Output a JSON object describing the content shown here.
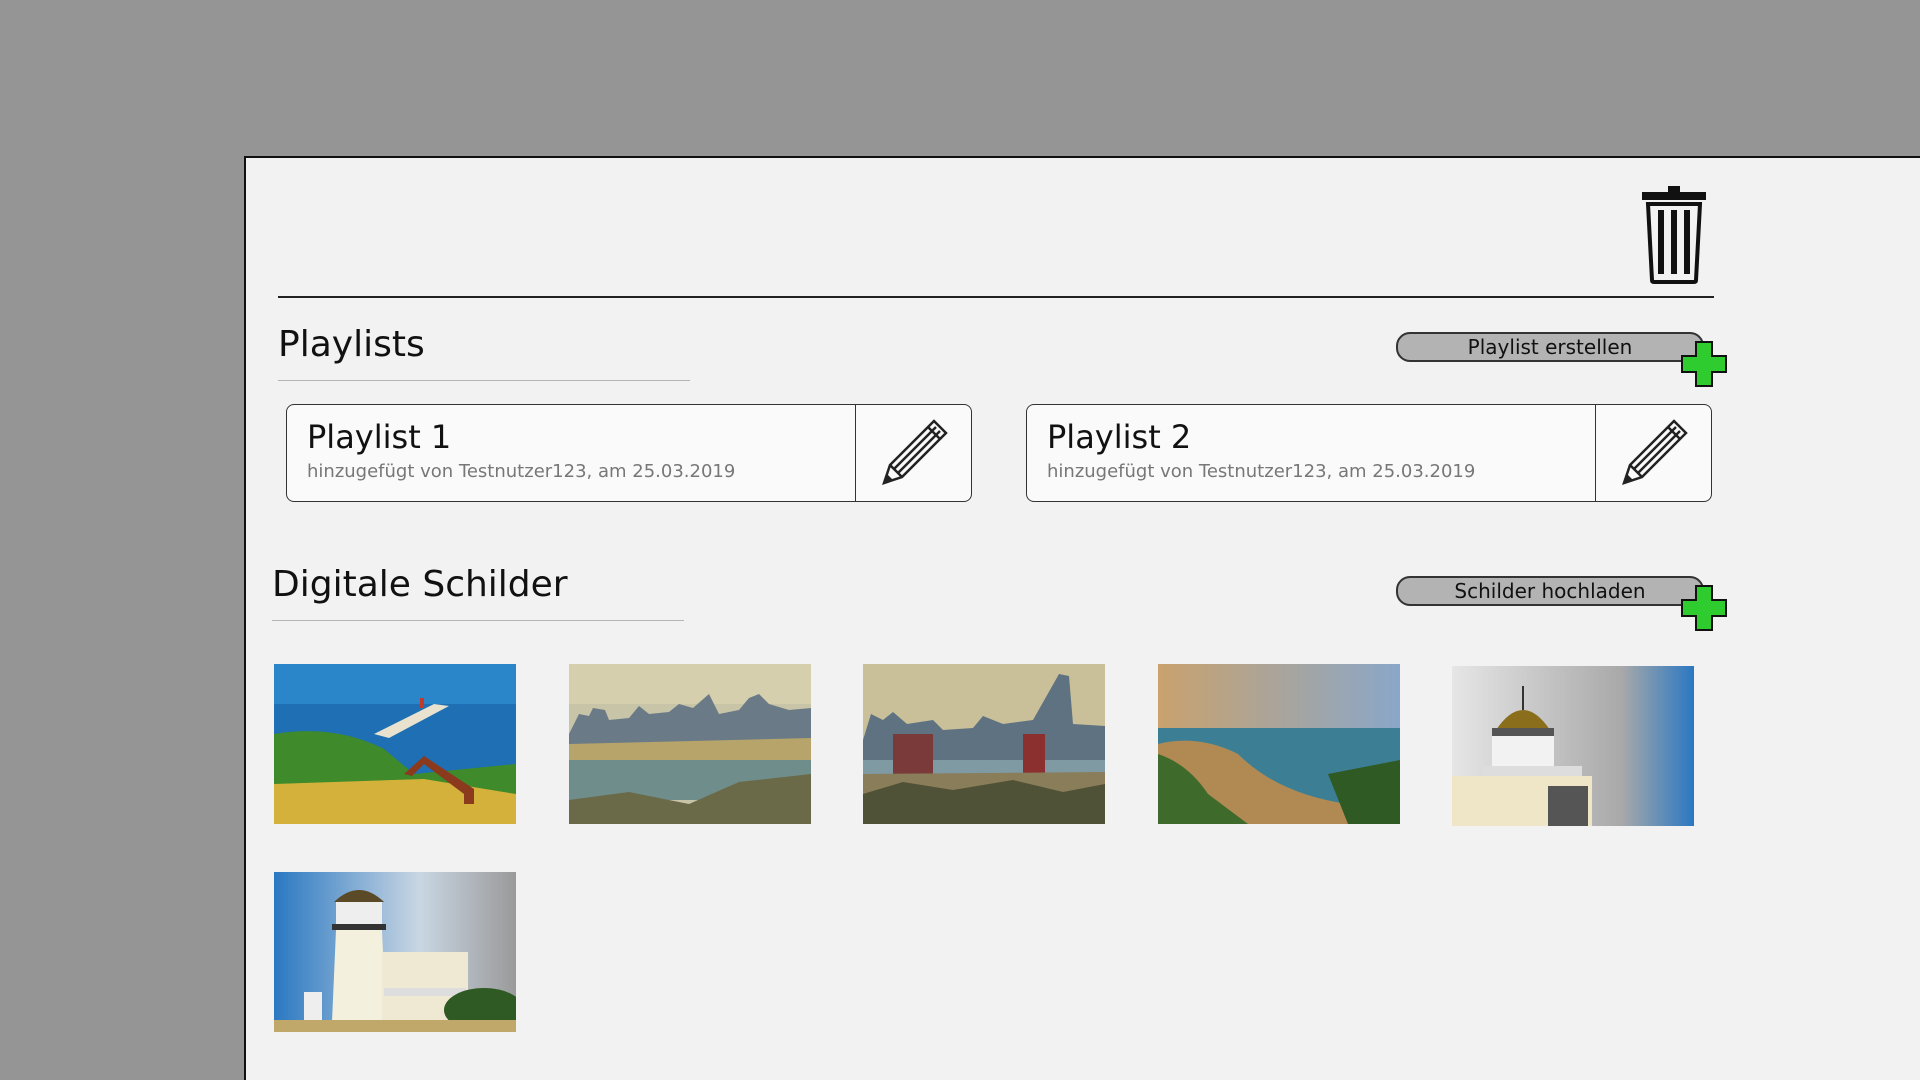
{
  "header": {
    "trash_icon": "trash-icon"
  },
  "playlists": {
    "title": "Playlists",
    "create_label": "Playlist erstellen",
    "items": [
      {
        "name": "Playlist 1",
        "meta": "hinzugefügt von Testnutzer123, am 25.03.2019"
      },
      {
        "name": "Playlist 2",
        "meta": "hinzugefügt von Testnutzer123, am 25.03.2019"
      }
    ]
  },
  "signs": {
    "title": "Digitale Schilder",
    "upload_label": "Schilder  hochladen",
    "thumbnails": [
      "coastal-pier-photo",
      "harbor-city-photo",
      "city-skyline-photo",
      "beach-bay-photo",
      "lighthouse-top-photo",
      "lighthouse-building-photo"
    ]
  },
  "colors": {
    "accent_plus": "#2ecc2e",
    "panel": "#f2f2f2",
    "backdrop": "#959595"
  }
}
